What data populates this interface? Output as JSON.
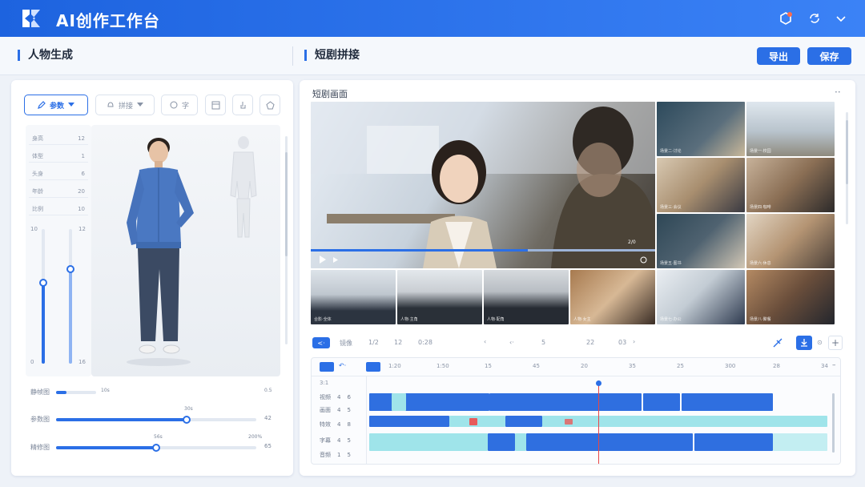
{
  "app": {
    "title": "AI创作工作台"
  },
  "header": {
    "icons": [
      "hexagon-icon",
      "sync-icon",
      "chevron-down-icon"
    ]
  },
  "sections": {
    "left_title": "人物生成",
    "right_title": "短剧拼接"
  },
  "actions": {
    "export_label": "导出",
    "save_label": "保存"
  },
  "left_panel": {
    "tools": [
      {
        "label": "参数",
        "active": true
      },
      {
        "label": "拼接"
      },
      {
        "label": "字"
      }
    ],
    "params": [
      {
        "label": "身高",
        "value": "12"
      },
      {
        "label": "体型",
        "value": "1"
      },
      {
        "label": "头身",
        "value": "6"
      },
      {
        "label": "年龄",
        "value": "20"
      },
      {
        "label": "比例",
        "value": "10"
      }
    ],
    "vsliders": {
      "left_top": "10",
      "left_bottom": "0",
      "right_top": "12",
      "right_bottom": "16",
      "left_level": 0.6,
      "right_level": 0.7
    },
    "hsliders": [
      {
        "label": "静帧图",
        "min": "10s",
        "max": "0.5",
        "level": 0.25,
        "value": ""
      },
      {
        "label": "参数图",
        "min": "",
        "max": "42",
        "level": 0.65,
        "value": "30s"
      },
      {
        "label": "精修图",
        "min": "",
        "max": "200%",
        "level": 0.5,
        "value": "56s",
        "end": "65"
      }
    ]
  },
  "right_panel": {
    "title": "短剧画面",
    "preview_time": "2/0",
    "thumbs": [
      {
        "caption": "场景二·讨论"
      },
      {
        "caption": "场景一·校园"
      },
      {
        "caption": "场景三·会议"
      },
      {
        "caption": "场景四·咖啡"
      },
      {
        "caption": "场景五·图书"
      },
      {
        "caption": "场景六·休息"
      },
      {
        "caption": "合影·全体"
      },
      {
        "caption": "人物·主角"
      },
      {
        "caption": "人物·配角"
      },
      {
        "caption": "人物·女主"
      },
      {
        "caption": "场景七·办公"
      },
      {
        "caption": "场景八·聚餐"
      }
    ],
    "toolbar": {
      "mode": "镜像",
      "frames": "1/2",
      "count": "12",
      "duration": "0:28",
      "pos": "5",
      "zoom": "22",
      "page": "03"
    },
    "timeline": {
      "ticks": [
        "1:20",
        "1:50",
        "15",
        "45",
        "20",
        "35",
        "25",
        "300",
        "28",
        "34"
      ],
      "head": "3:1",
      "tracks": [
        {
          "label": "视频",
          "a": "4",
          "b": "6"
        },
        {
          "label": "画面",
          "a": "4",
          "b": "5"
        },
        {
          "label": "特效",
          "a": "4",
          "b": "8"
        },
        {
          "label": "字幕",
          "a": "4",
          "b": "5"
        },
        {
          "label": "音频",
          "a": "1",
          "b": "5"
        }
      ]
    }
  },
  "colors": {
    "accent": "#2b6fe6",
    "header": "#1d63df",
    "clip_blue": "#2f6fe0",
    "clip_cyan": "#9fe4ea",
    "playhead": "#e84646"
  }
}
